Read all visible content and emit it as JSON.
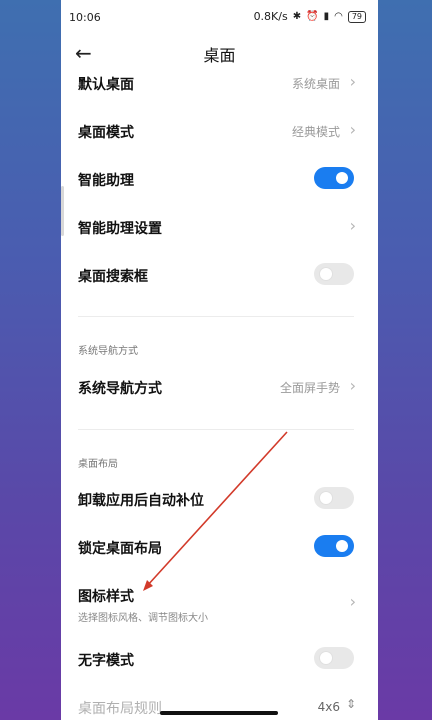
{
  "status_bar": {
    "time": "10:06",
    "speed": "0.8K/s",
    "battery": "79"
  },
  "header": {
    "title": "桌面"
  },
  "items": {
    "default_desktop": {
      "label": "默认桌面",
      "value": "系统桌面"
    },
    "desktop_mode": {
      "label": "桌面模式",
      "value": "经典模式"
    },
    "smart_assistant": {
      "label": "智能助理",
      "toggle": "on"
    },
    "smart_assistant_settings": {
      "label": "智能助理设置"
    },
    "desktop_search": {
      "label": "桌面搜索框",
      "toggle": "off"
    },
    "nav_section": "系统导航方式",
    "nav_mode": {
      "label": "系统导航方式",
      "value": "全面屏手势"
    },
    "layout_section": "桌面布局",
    "auto_fill": {
      "label": "卸载应用后自动补位",
      "toggle": "off"
    },
    "lock_layout": {
      "label": "锁定桌面布局",
      "toggle": "on"
    },
    "icon_style": {
      "label": "图标样式",
      "sub": "选择图标风格、调节图标大小"
    },
    "no_text_mode": {
      "label": "无字模式",
      "toggle": "off"
    },
    "layout_rule": {
      "label": "桌面布局规则",
      "value": "4x6"
    }
  },
  "colors": {
    "accent": "#1a7df0",
    "annotation_arrow": "#d23a2a"
  }
}
